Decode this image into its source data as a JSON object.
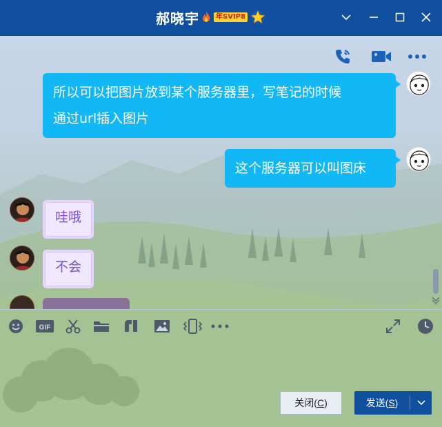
{
  "window": {
    "contact_name": "郝晓宇",
    "vip_badge": "年SVIP8",
    "minimize_label": "minimize",
    "maximize_label": "maximize",
    "close_label": "close"
  },
  "top_toolbar": {
    "icons": [
      "voice-call-icon",
      "video-call-icon",
      "more-icon"
    ]
  },
  "messages": [
    {
      "direction": "out",
      "lines": [
        "所以可以把图片放到某个服务器里，写笔记的时候",
        "通过url插入图片"
      ]
    },
    {
      "direction": "out",
      "lines": [
        "这个服务器可以叫图床"
      ]
    },
    {
      "direction": "in",
      "lines": [
        "哇哦"
      ]
    },
    {
      "direction": "in",
      "lines": [
        "不会"
      ]
    }
  ],
  "input_toolbar": {
    "icons": [
      "emoji-icon",
      "gif-icon",
      "screenshot-icon",
      "folder-icon",
      "doc-icon",
      "image-icon",
      "shake-icon",
      "more-icon",
      "expand-icon",
      "history-icon"
    ],
    "gif_label": "GIF"
  },
  "actions": {
    "close_label": "关闭(",
    "close_key": "C",
    "close_suffix": ")",
    "send_label": "发送(",
    "send_key": "S",
    "send_suffix": ")"
  },
  "colors": {
    "titlebar": "#0f4f9e",
    "bubble_out": "#12b7f5",
    "bubble_in_bg": "#efe8ff",
    "bubble_in_text": "#7b4fd0"
  }
}
